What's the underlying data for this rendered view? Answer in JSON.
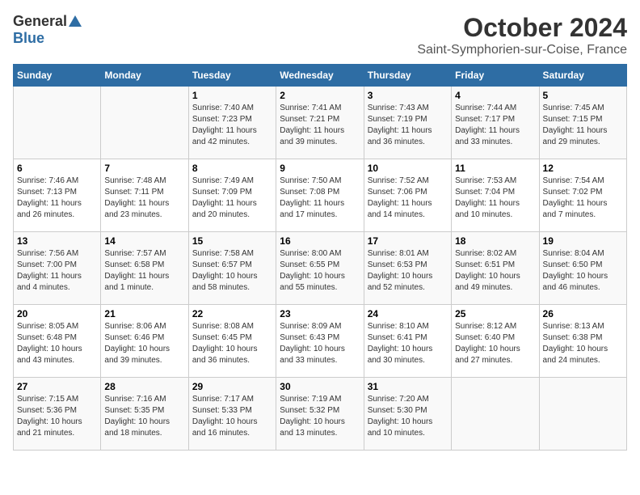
{
  "logo": {
    "line1": "General",
    "line2": "Blue"
  },
  "title": "October 2024",
  "subtitle": "Saint-Symphorien-sur-Coise, France",
  "headers": [
    "Sunday",
    "Monday",
    "Tuesday",
    "Wednesday",
    "Thursday",
    "Friday",
    "Saturday"
  ],
  "weeks": [
    [
      {
        "day": "",
        "info": ""
      },
      {
        "day": "",
        "info": ""
      },
      {
        "day": "1",
        "info": "Sunrise: 7:40 AM\nSunset: 7:23 PM\nDaylight: 11 hours\nand 42 minutes."
      },
      {
        "day": "2",
        "info": "Sunrise: 7:41 AM\nSunset: 7:21 PM\nDaylight: 11 hours\nand 39 minutes."
      },
      {
        "day": "3",
        "info": "Sunrise: 7:43 AM\nSunset: 7:19 PM\nDaylight: 11 hours\nand 36 minutes."
      },
      {
        "day": "4",
        "info": "Sunrise: 7:44 AM\nSunset: 7:17 PM\nDaylight: 11 hours\nand 33 minutes."
      },
      {
        "day": "5",
        "info": "Sunrise: 7:45 AM\nSunset: 7:15 PM\nDaylight: 11 hours\nand 29 minutes."
      }
    ],
    [
      {
        "day": "6",
        "info": "Sunrise: 7:46 AM\nSunset: 7:13 PM\nDaylight: 11 hours\nand 26 minutes."
      },
      {
        "day": "7",
        "info": "Sunrise: 7:48 AM\nSunset: 7:11 PM\nDaylight: 11 hours\nand 23 minutes."
      },
      {
        "day": "8",
        "info": "Sunrise: 7:49 AM\nSunset: 7:09 PM\nDaylight: 11 hours\nand 20 minutes."
      },
      {
        "day": "9",
        "info": "Sunrise: 7:50 AM\nSunset: 7:08 PM\nDaylight: 11 hours\nand 17 minutes."
      },
      {
        "day": "10",
        "info": "Sunrise: 7:52 AM\nSunset: 7:06 PM\nDaylight: 11 hours\nand 14 minutes."
      },
      {
        "day": "11",
        "info": "Sunrise: 7:53 AM\nSunset: 7:04 PM\nDaylight: 11 hours\nand 10 minutes."
      },
      {
        "day": "12",
        "info": "Sunrise: 7:54 AM\nSunset: 7:02 PM\nDaylight: 11 hours\nand 7 minutes."
      }
    ],
    [
      {
        "day": "13",
        "info": "Sunrise: 7:56 AM\nSunset: 7:00 PM\nDaylight: 11 hours\nand 4 minutes."
      },
      {
        "day": "14",
        "info": "Sunrise: 7:57 AM\nSunset: 6:58 PM\nDaylight: 11 hours\nand 1 minute."
      },
      {
        "day": "15",
        "info": "Sunrise: 7:58 AM\nSunset: 6:57 PM\nDaylight: 10 hours\nand 58 minutes."
      },
      {
        "day": "16",
        "info": "Sunrise: 8:00 AM\nSunset: 6:55 PM\nDaylight: 10 hours\nand 55 minutes."
      },
      {
        "day": "17",
        "info": "Sunrise: 8:01 AM\nSunset: 6:53 PM\nDaylight: 10 hours\nand 52 minutes."
      },
      {
        "day": "18",
        "info": "Sunrise: 8:02 AM\nSunset: 6:51 PM\nDaylight: 10 hours\nand 49 minutes."
      },
      {
        "day": "19",
        "info": "Sunrise: 8:04 AM\nSunset: 6:50 PM\nDaylight: 10 hours\nand 46 minutes."
      }
    ],
    [
      {
        "day": "20",
        "info": "Sunrise: 8:05 AM\nSunset: 6:48 PM\nDaylight: 10 hours\nand 43 minutes."
      },
      {
        "day": "21",
        "info": "Sunrise: 8:06 AM\nSunset: 6:46 PM\nDaylight: 10 hours\nand 39 minutes."
      },
      {
        "day": "22",
        "info": "Sunrise: 8:08 AM\nSunset: 6:45 PM\nDaylight: 10 hours\nand 36 minutes."
      },
      {
        "day": "23",
        "info": "Sunrise: 8:09 AM\nSunset: 6:43 PM\nDaylight: 10 hours\nand 33 minutes."
      },
      {
        "day": "24",
        "info": "Sunrise: 8:10 AM\nSunset: 6:41 PM\nDaylight: 10 hours\nand 30 minutes."
      },
      {
        "day": "25",
        "info": "Sunrise: 8:12 AM\nSunset: 6:40 PM\nDaylight: 10 hours\nand 27 minutes."
      },
      {
        "day": "26",
        "info": "Sunrise: 8:13 AM\nSunset: 6:38 PM\nDaylight: 10 hours\nand 24 minutes."
      }
    ],
    [
      {
        "day": "27",
        "info": "Sunrise: 7:15 AM\nSunset: 5:36 PM\nDaylight: 10 hours\nand 21 minutes."
      },
      {
        "day": "28",
        "info": "Sunrise: 7:16 AM\nSunset: 5:35 PM\nDaylight: 10 hours\nand 18 minutes."
      },
      {
        "day": "29",
        "info": "Sunrise: 7:17 AM\nSunset: 5:33 PM\nDaylight: 10 hours\nand 16 minutes."
      },
      {
        "day": "30",
        "info": "Sunrise: 7:19 AM\nSunset: 5:32 PM\nDaylight: 10 hours\nand 13 minutes."
      },
      {
        "day": "31",
        "info": "Sunrise: 7:20 AM\nSunset: 5:30 PM\nDaylight: 10 hours\nand 10 minutes."
      },
      {
        "day": "",
        "info": ""
      },
      {
        "day": "",
        "info": ""
      }
    ]
  ]
}
